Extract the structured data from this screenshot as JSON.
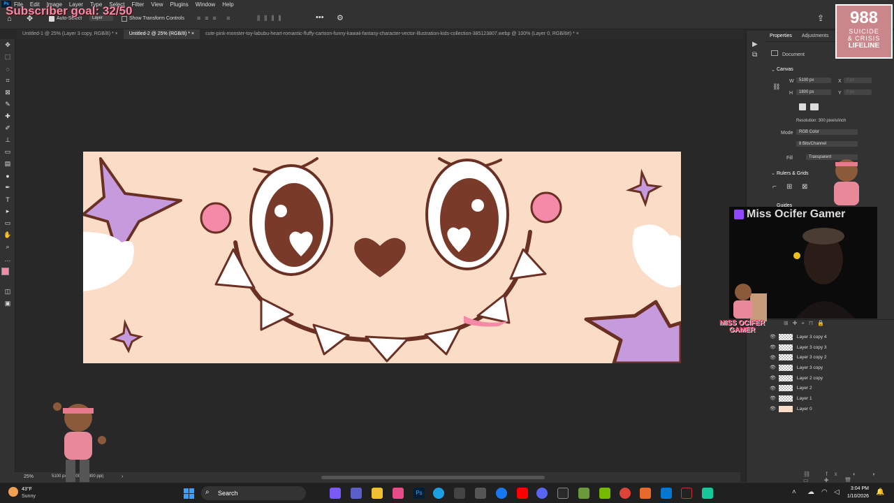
{
  "overlay": {
    "subscriber_goal": "Subscriber goal: 32/50",
    "lifeline_number": "988",
    "lifeline_text1": "SUICIDE",
    "lifeline_text2": "& CRISIS",
    "lifeline_text3": "LIFELINE",
    "webcam_name": "Miss Ocifer Gamer",
    "gamer_logo_line1": "MISS OCIFER",
    "gamer_logo_line2": "GAMER"
  },
  "menu": [
    "File",
    "Edit",
    "Image",
    "Layer",
    "Type",
    "Select",
    "Filter",
    "View",
    "Plugins",
    "Window",
    "Help"
  ],
  "options": {
    "auto_select": "Auto-Select",
    "layer_select": "Layer",
    "show_transform": "Show Transform Controls"
  },
  "tabs": [
    {
      "label": "Untitled-1 @ 25% (Layer 3 copy, RGB/8) *",
      "active": false
    },
    {
      "label": "Untitled-2 @ 25% (RGB/8) *",
      "active": true
    },
    {
      "label": "cute-pink-monster-toy-labubu-heart-romantic-fluffy-cartoon-funny-kawaii-fantasy-character-vector-illustration-kids-collection-385123807.webp @ 100% (Layer 0, RGB/8#) *",
      "active": false
    }
  ],
  "status": {
    "zoom": "25%",
    "dimensions": "5100 px x 1800 px (300 ppi)"
  },
  "properties": {
    "tab_properties": "Properties",
    "tab_adjustments": "Adjustments",
    "document_label": "Document",
    "canvas_heading": "Canvas",
    "w_label": "W",
    "w_value": "5100 px",
    "h_label": "H",
    "h_value": "1800 px",
    "x_label": "X",
    "x_value": "0 px",
    "y_label": "Y",
    "y_value": "0 px",
    "resolution": "Resolution: 300 pixels/inch",
    "mode_label": "Mode",
    "mode_value": "RGB Color",
    "bits_value": "8 Bits/Channel",
    "fill_label": "Fill",
    "fill_value": "Transparent",
    "rulers_heading": "Rulers & Grids",
    "guides_heading": "Guides"
  },
  "layers": [
    {
      "name": "Layer 3 copy 4"
    },
    {
      "name": "Layer 3 copy 3"
    },
    {
      "name": "Layer 3 copy 2"
    },
    {
      "name": "Layer 3 copy"
    },
    {
      "name": "Layer 2 copy"
    },
    {
      "name": "Layer 2"
    },
    {
      "name": "Layer 1"
    },
    {
      "name": "Layer 0"
    }
  ],
  "weather": {
    "temp": "43°F",
    "condition": "Sunny"
  },
  "taskbar": {
    "search_placeholder": "Search",
    "time": "3:04 PM",
    "date": "1/10/2026"
  },
  "colors": {
    "foreground": "#f48aa8",
    "canvas_bg": "#fbdcc7",
    "accent_brown": "#6b3024"
  }
}
